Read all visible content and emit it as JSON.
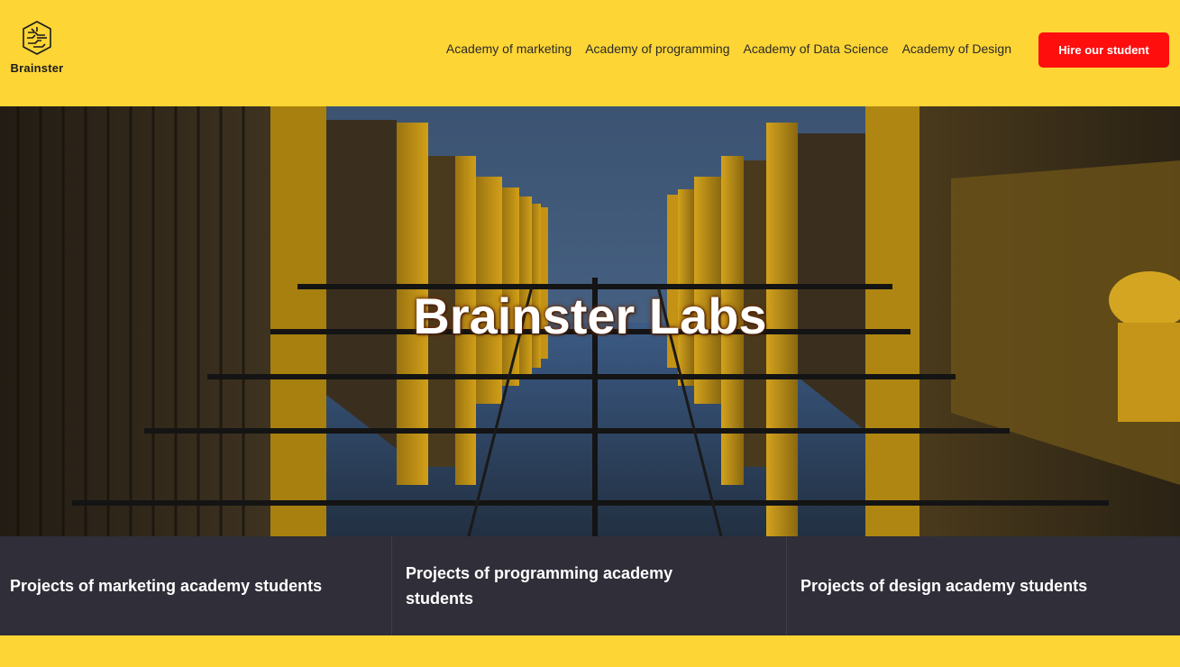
{
  "brand": {
    "name": "Brainster",
    "logo_icon": "brain-icon"
  },
  "nav": {
    "items": [
      {
        "label": "Academy of marketing"
      },
      {
        "label": "Academy of programming"
      },
      {
        "label": "Academy of Data Science"
      },
      {
        "label": "Academy of Design"
      }
    ],
    "cta": "Hire our student"
  },
  "hero": {
    "title": "Brainster Labs"
  },
  "cards": [
    {
      "label": "Projects of marketing academy students"
    },
    {
      "label": "Projects of programming academy students"
    },
    {
      "label": "Projects of design academy students"
    }
  ],
  "colors": {
    "accent": "#fdd535",
    "cta": "#ff0e0e",
    "card_bg": "#302e38"
  }
}
